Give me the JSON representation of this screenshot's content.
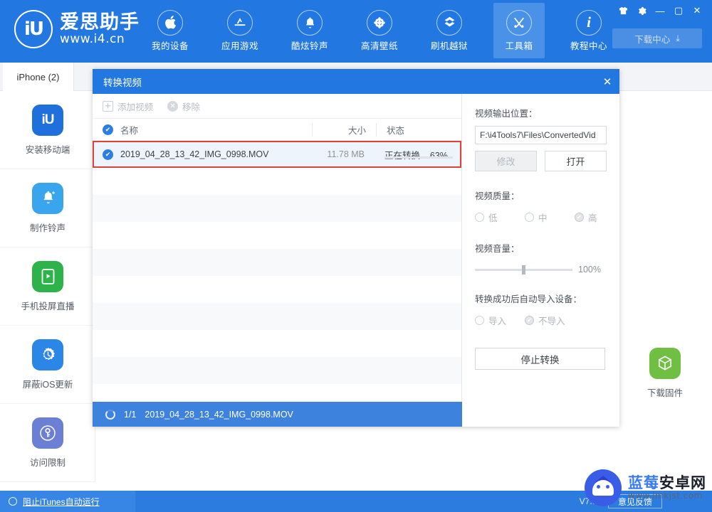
{
  "header": {
    "brand": {
      "logo_text": "iU",
      "name": "爱思助手",
      "url": "www.i4.cn"
    },
    "nav": [
      {
        "label": "我的设备",
        "icon": "apple-icon",
        "glyph": "",
        "active": false
      },
      {
        "label": "应用游戏",
        "icon": "appstore-icon",
        "glyph": "A",
        "active": false
      },
      {
        "label": "酷炫铃声",
        "icon": "bell-icon",
        "glyph": "🔔",
        "active": false
      },
      {
        "label": "高清壁纸",
        "icon": "flower-icon",
        "glyph": "✾",
        "active": false
      },
      {
        "label": "刷机越狱",
        "icon": "box-open-icon",
        "glyph": "⛊",
        "active": false
      },
      {
        "label": "工具箱",
        "icon": "tools-icon",
        "glyph": "⚒",
        "active": true
      },
      {
        "label": "教程中心",
        "icon": "info-icon",
        "glyph": "i",
        "active": false
      }
    ],
    "window_controls": [
      {
        "name": "skin-icon",
        "glyph": "♣"
      },
      {
        "name": "settings-gear-icon",
        "glyph": "✿"
      },
      {
        "name": "minimize-icon",
        "glyph": "—"
      },
      {
        "name": "maximize-icon",
        "glyph": "▢"
      },
      {
        "name": "close-icon",
        "glyph": "✕"
      }
    ],
    "download_center": {
      "label": "下载中心",
      "icon_glyph": "⤓"
    }
  },
  "tabs": [
    {
      "label": "iPhone (2)",
      "active": true
    }
  ],
  "left_tools": [
    {
      "label": "安装移动端",
      "icon": "i4-app-icon",
      "glyph": "iU",
      "color": "#1f6fdd"
    },
    {
      "label": "制作铃声",
      "icon": "ringtone-bell-icon",
      "glyph": "🔔",
      "color": "#39a5ef"
    },
    {
      "label": "手机投屏直播",
      "icon": "screen-cast-icon",
      "glyph": "▶",
      "color": "#2eb34a"
    },
    {
      "label": "屏蔽iOS更新",
      "icon": "block-update-icon",
      "glyph": "⚙",
      "color": "#2b86e8"
    },
    {
      "label": "访问限制",
      "icon": "key-lock-icon",
      "glyph": "⚲",
      "color": "#6b7fd4"
    }
  ],
  "right_tools": [
    {
      "label": "下载固件",
      "icon": "firmware-box-icon",
      "glyph": "⬢",
      "color": "#6fbf43"
    }
  ],
  "dialog": {
    "title": "转换视频",
    "close_glyph": "✕",
    "toolbar": [
      {
        "label": "添加视频",
        "icon": "add-video-icon",
        "glyph": "+",
        "disabled": true
      },
      {
        "label": "移除",
        "icon": "remove-icon",
        "glyph": "✕",
        "disabled": true
      }
    ],
    "columns": {
      "name": "名称",
      "size": "大小",
      "status": "状态"
    },
    "rows": [
      {
        "name": "2019_04_28_13_42_IMG_0998.MOV",
        "size": "11.78 MB",
        "status": "正在转换... 63%",
        "progress": 63,
        "selected": true,
        "checked": true
      }
    ],
    "empty_row_count": 8,
    "footer": {
      "counter": "1/1",
      "filename": "2019_04_28_13_42_IMG_0998.MOV"
    },
    "panel": {
      "output_label": "视频输出位置：",
      "output_path": "F:\\i4Tools7\\Files\\ConvertedVid",
      "modify_button": "修改",
      "open_button": "打开",
      "quality_label": "视频质量：",
      "quality_options": [
        {
          "label": "低",
          "checked": false
        },
        {
          "label": "中",
          "checked": false
        },
        {
          "label": "高",
          "checked": true
        }
      ],
      "volume_label": "视频音量：",
      "volume_value": "100%",
      "volume_percent": 100,
      "auto_import_label": "转换成功后自动导入设备：",
      "auto_import_options": [
        {
          "label": "导入",
          "checked": false
        },
        {
          "label": "不导入",
          "checked": true
        }
      ],
      "stop_button": "停止转换"
    }
  },
  "statusbar": {
    "itunes_toggle": "阻止iTunes自动运行",
    "version": "V7.93",
    "feedback": "意见反馈"
  },
  "watermark": {
    "title_part1": "蓝莓",
    "title_part2": "安卓网",
    "url": "www.lmkjst.com"
  },
  "colors": {
    "brand_blue": "#2277e0",
    "accent_blue": "#3a8ee6",
    "selection_red": "#d8443c",
    "footer_blue": "#3d82dd"
  }
}
